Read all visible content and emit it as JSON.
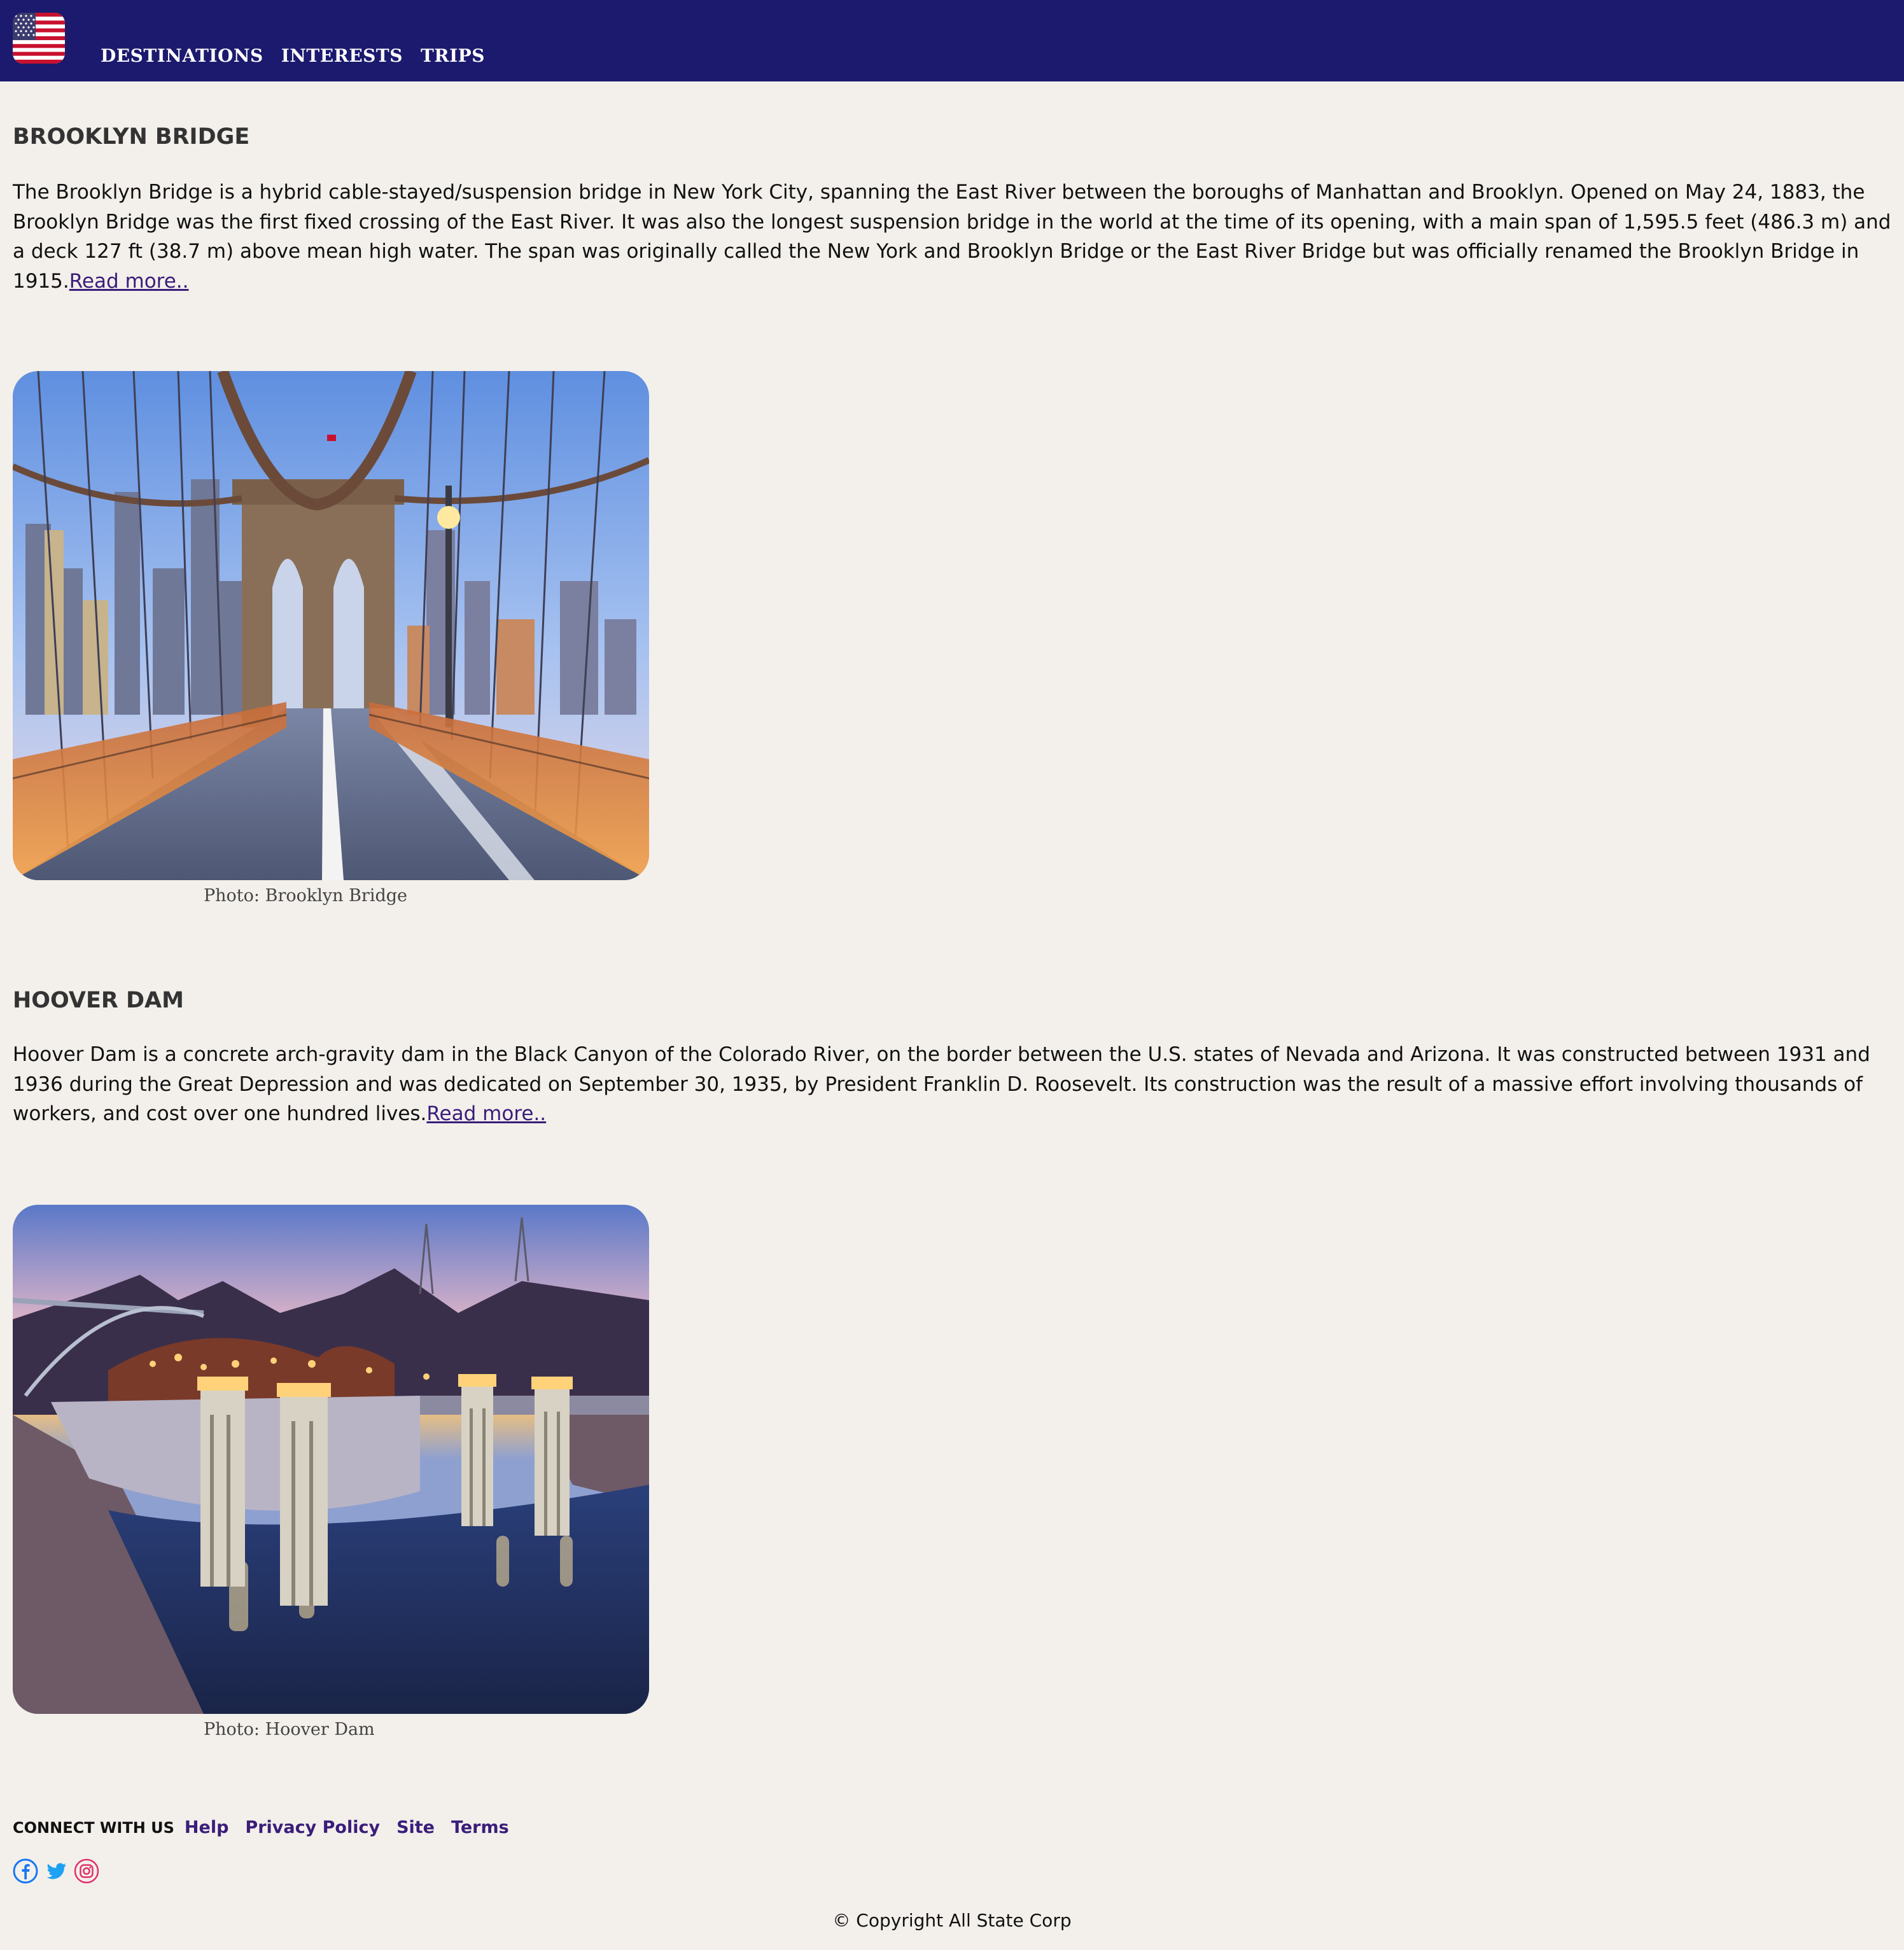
{
  "header": {
    "logo_icon": "us-flag-icon",
    "nav": [
      "DESTINATIONS",
      "INTERESTS",
      "TRIPS"
    ],
    "colors": {
      "bar": "#1b1a6e",
      "text": "#ffffff"
    }
  },
  "sections": [
    {
      "title": "BROOKLYN BRIDGE",
      "body": "The Brooklyn Bridge is a hybrid cable-stayed/suspension bridge in New York City, spanning the East River between the boroughs of Manhattan and Brooklyn. Opened on May 24, 1883, the Brooklyn Bridge was the first fixed crossing of the East River. It was also the longest suspension bridge in the world at the time of its opening, with a main span of 1,595.5 feet (486.3 m) and a deck 127 ft (38.7 m) above mean high water. The span was originally called the New York and Brooklyn Bridge or the East River Bridge but was officially renamed the Brooklyn Bridge in 1915.",
      "read_more": "Read more..",
      "caption": "Photo: Brooklyn Bridge"
    },
    {
      "title": "HOOVER DAM",
      "body": "Hoover Dam is a concrete arch-gravity dam in the Black Canyon of the Colorado River, on the border between the U.S. states of Nevada and Arizona. It was constructed between 1931 and 1936 during the Great Depression and was dedicated on September 30, 1935, by President Franklin D. Roosevelt. Its construction was the result of a massive effort involving thousands of workers, and cost over one hundred lives.",
      "read_more": "Read more..",
      "caption": "Photo: Hoover Dam"
    }
  ],
  "footer": {
    "connect_label": "CONNECT WITH US",
    "links": [
      "Help",
      "Privacy Policy",
      "Site",
      "Terms"
    ],
    "social_icons": [
      "facebook-icon",
      "twitter-icon",
      "instagram-icon"
    ],
    "copyright": "© Copyright All State Corp",
    "link_color": "#3a1d7a",
    "background": "#f3f0eb"
  }
}
